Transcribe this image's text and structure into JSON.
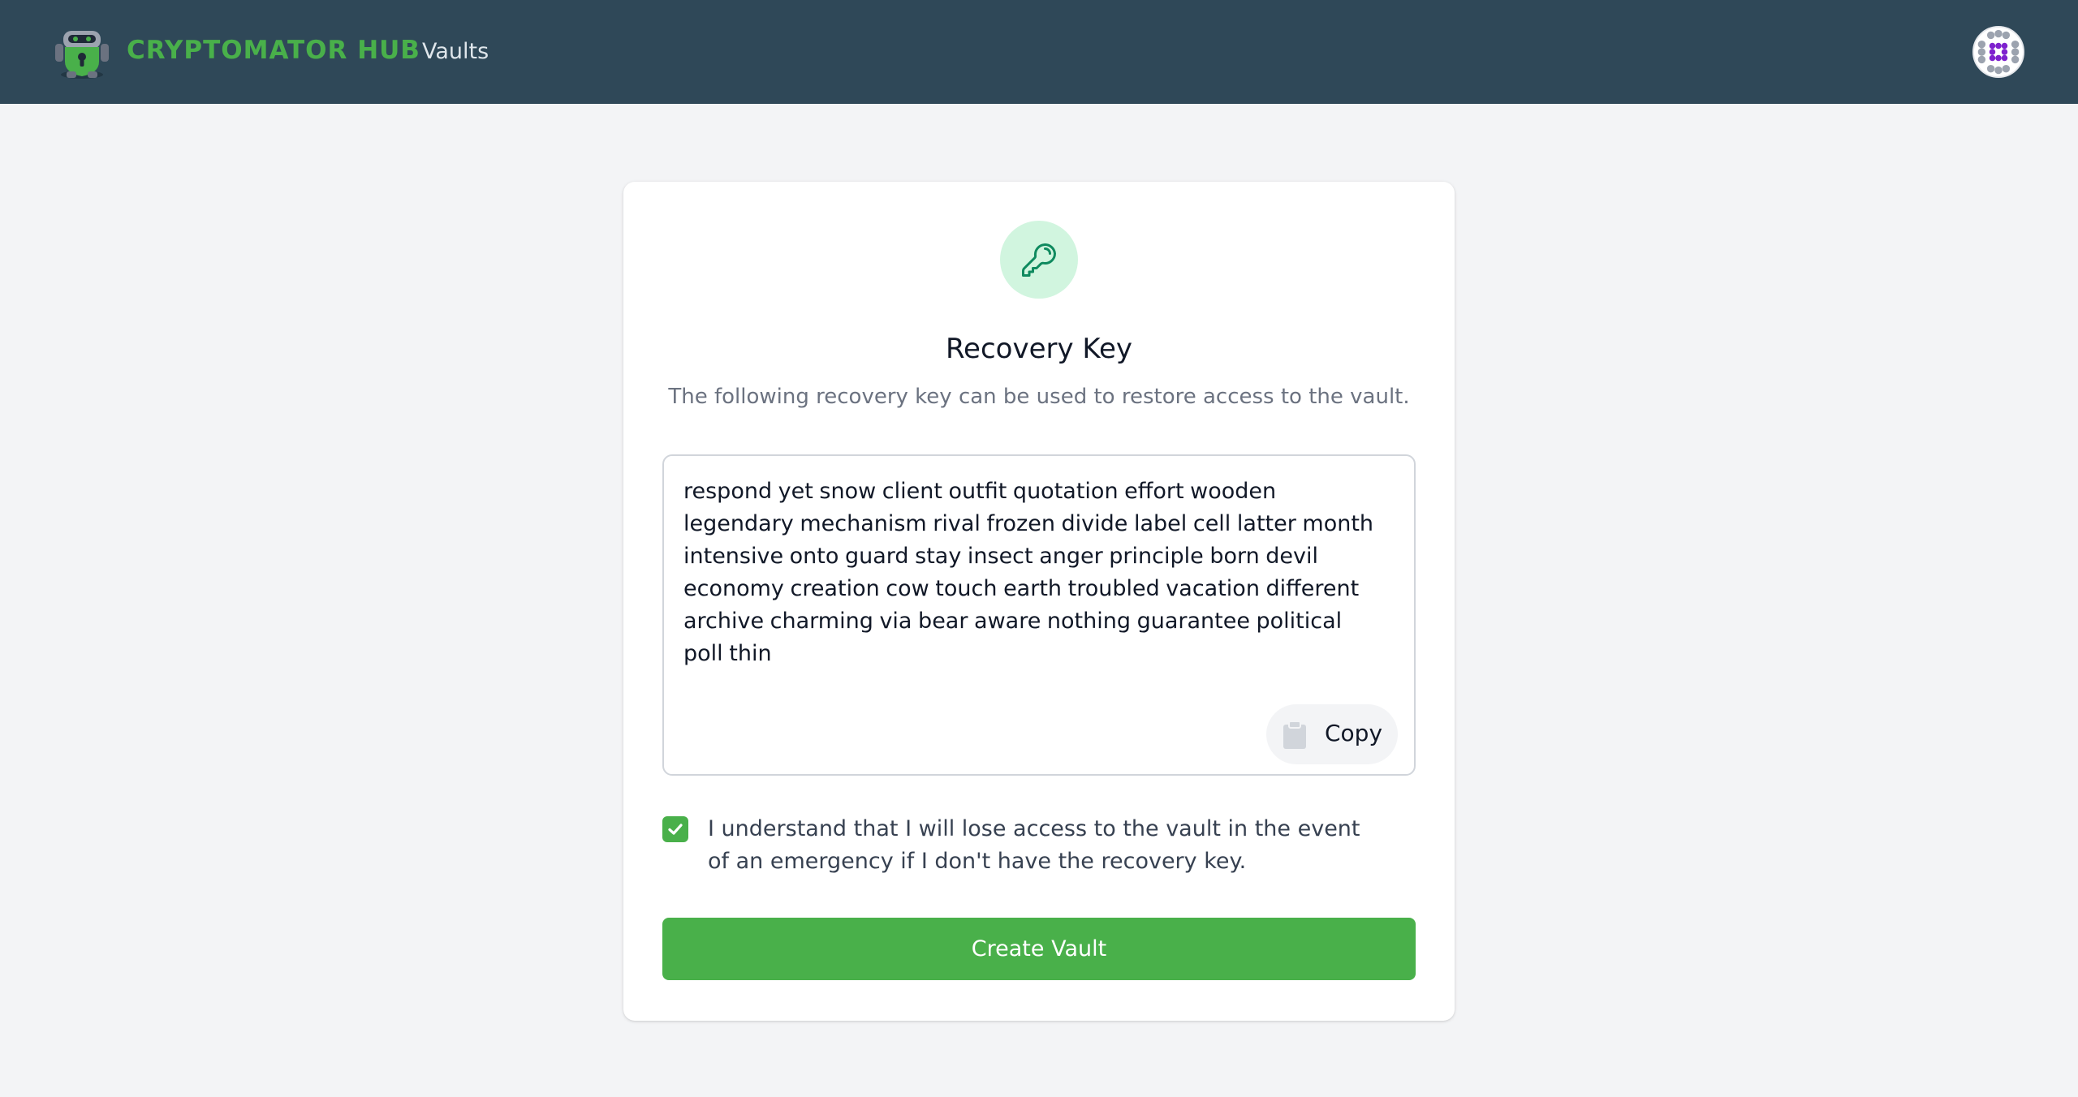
{
  "header": {
    "brand": "CRYPTOMATOR HUB",
    "nav_vaults": "Vaults",
    "logo_icon": "robot-lock-logo-icon",
    "avatar_icon": "identicon-avatar"
  },
  "card": {
    "icon": "key-icon",
    "title": "Recovery Key",
    "subtitle": "The following recovery key can be used to restore access to the vault.",
    "recovery_key": "respond yet snow client outfit quotation effort wooden legendary mechanism rival frozen divide label cell latter month intensive onto guard stay insect anger principle born devil economy creation cow touch earth troubled vacation different archive charming via bear aware nothing guarantee political poll thin",
    "copy_label": "Copy",
    "copy_icon": "clipboard-icon",
    "checkbox_checked": true,
    "checkbox_label": "I understand that I will lose access to the vault in the event of an emergency if I don't have the recovery key.",
    "create_label": "Create Vault"
  },
  "colors": {
    "header_bg": "#2f4858",
    "brand_green": "#49b04a",
    "page_bg": "#f3f4f6",
    "key_badge_bg": "#d1f5df",
    "key_icon": "#0f8a5f"
  }
}
